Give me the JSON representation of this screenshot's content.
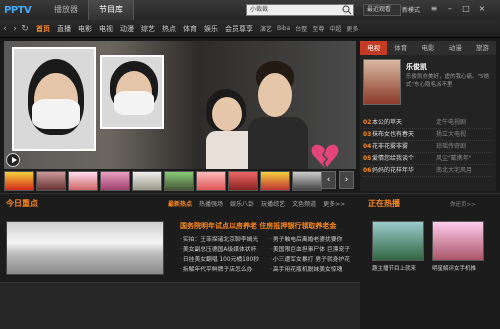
{
  "titlebar": {
    "logo": "PPTV",
    "tabs": [
      "播放器",
      "节目库"
    ],
    "search_value": "小裁裁",
    "recent": "最近观看",
    "newmode": "新模式"
  },
  "nav": {
    "items": [
      "首页",
      "直播",
      "电影",
      "电视",
      "动漫",
      "综艺",
      "热点",
      "体育",
      "娱乐",
      "会员尊享"
    ],
    "small_items": [
      "演艺",
      "Biba",
      "台整",
      "至尊",
      "中超",
      "更多"
    ]
  },
  "right_panel": {
    "tabs": [
      "电视",
      "体育",
      "电影",
      "动漫",
      "旅游"
    ],
    "featured_title": "乐俊凯",
    "featured_desc": "乐俊凯亦美好，虚的我心痛。\"5她式\"东心隐毛派不里",
    "rankings": [
      {
        "num": "02",
        "title": "本公的苹天",
        "sub": "走牛电视剧"
      },
      {
        "num": "03",
        "title": "抹布女也有春天",
        "sub": "扬立大电视"
      },
      {
        "num": "04",
        "title": "花非花雾非雾",
        "sub": "琼瑶传奇剧"
      },
      {
        "num": "05",
        "title": "爱情您给我谈个",
        "sub": "风尘\"戴携年\""
      },
      {
        "num": "06",
        "title": "妈妈的花样年华",
        "sub": "南北大宅风月"
      }
    ]
  },
  "bottom": {
    "section_title": "今日重点",
    "tabs": [
      "最新热点",
      "热播强场",
      "娱乐八卦",
      "玩播综艺",
      "文色频道",
      "更多>>"
    ],
    "headline": "国务院明年试点以房养老 住房抵押银行领取养老金",
    "col1": [
      "实拍：王菲探诸北京聊李嫣光",
      "美女副总压德国A级媒体状杯",
      "日挂美女翻唱 100元橘180秒",
      "拆解年代平鲜牌子店怎么办"
    ],
    "col2": [
      "男子触电后离婚老婆扰要你",
      "美国限巨血担事尸体 巨漂宠子",
      "小三遭军女暴打 男子就身护花",
      "高手用花瓶机脱妹美女惊魂"
    ],
    "live_title": "正在热播",
    "live_more": "你还页>>",
    "live_caps": [
      "趣主播节目上就来",
      "明星解评女手机推"
    ]
  }
}
